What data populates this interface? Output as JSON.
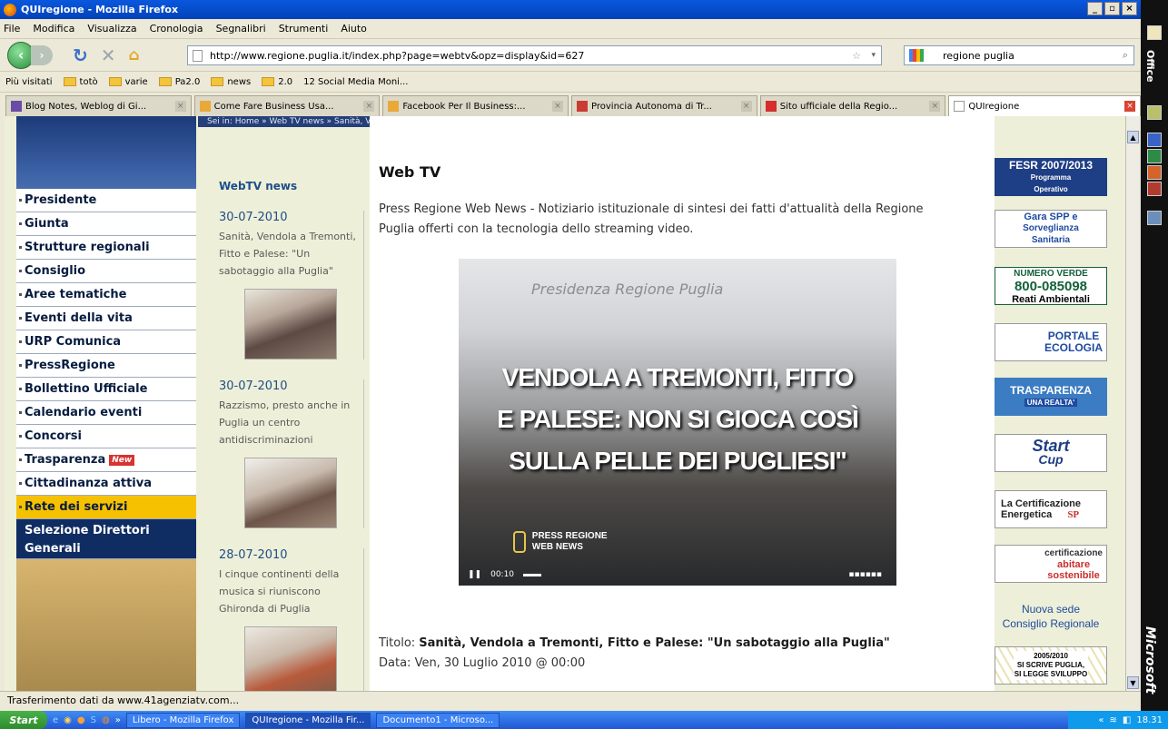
{
  "window": {
    "title": "QUIregione - Mozilla Firefox",
    "buttons": [
      "_",
      "▫",
      "×"
    ]
  },
  "menu": [
    "File",
    "Modifica",
    "Visualizza",
    "Cronologia",
    "Segnalibri",
    "Strumenti",
    "Aiuto"
  ],
  "nav": {
    "url": "http://www.regione.puglia.it/index.php?page=webtv&opz=display&id=627",
    "search": "regione puglia"
  },
  "bookmarks": [
    "Più visitati",
    "totò",
    "varie",
    "Pa2.0",
    "news",
    "2.0",
    "12 Social Media Moni..."
  ],
  "tabs": [
    "Blog Notes, Weblog di Gi...",
    "Come Fare Business Usa...",
    "Facebook Per Il Business:...",
    "Provincia Autonoma di Tr...",
    "Sito ufficiale della Regio...",
    "QUIregione"
  ],
  "breadcrumb": "Sei in: Home » Web TV news » Sanità, Vendola a Tremonti, Fitto e Palese: \"Un sabotaggio alla Puglia\"",
  "sidebar": {
    "items": [
      "Presidente",
      "Giunta",
      "Strutture regionali",
      "Consiglio",
      "Aree tematiche",
      "Eventi della vita",
      "URP Comunica",
      "PressRegione",
      "Bollettino Ufficiale",
      "Calendario eventi",
      "Concorsi",
      "Trasparenza",
      "Cittadinanza attiva",
      "Rete dei servizi",
      "Selezione Direttori Generali"
    ],
    "new_badge": "New"
  },
  "news": {
    "heading": "WebTV news",
    "items": [
      {
        "date": "30-07-2010",
        "text": "Sanità, Vendola a Tremonti, Fitto e Palese: \"Un sabotaggio alla Puglia\""
      },
      {
        "date": "30-07-2010",
        "text": "Razzismo, presto anche in Puglia un centro antidiscriminazioni"
      },
      {
        "date": "28-07-2010",
        "text": "I cinque continenti della musica si riuniscono Ghironda di Puglia"
      }
    ]
  },
  "main": {
    "title": "Web TV",
    "intro": "Press Regione Web News - Notiziario istituzionale di sintesi dei fatti d'attualità della Regione Puglia offerti con la tecnologia dello streaming video.",
    "video": {
      "banner": "Presidenza Regione Puglia",
      "caption_lines": [
        "VENDOLA A TREMONTI, FITTO",
        "E PALESE: NON SI GIOCA COSÌ",
        "SULLA PELLE DEI PUGLIESI\""
      ],
      "logo": [
        "PRESS REGIONE",
        "WEB NEWS"
      ],
      "time": "00:10"
    },
    "meta_title_label": "Titolo:",
    "meta_title": "Sanità, Vendola a Tremonti, Fitto e Palese: \"Un sabotaggio alla Puglia\"",
    "meta_date_label": "Data:",
    "meta_date": "Ven, 30 Luglio 2010 @ 00:00"
  },
  "banners": [
    {
      "line1": "FESR 2007/2013",
      "line2": "Programma",
      "line3": "Operativo"
    },
    {
      "line1": "Gara SPP e",
      "line2": "Sorveglianza",
      "line3": "Sanitaria"
    },
    {
      "line1": "NUMERO VERDE",
      "line2": "800-085098",
      "line3": "Reati Ambientali"
    },
    {
      "line1": "PORTALE",
      "line2": "ECOLOGIA",
      "line3": ""
    },
    {
      "line1": "TRASPARENZA",
      "line2": "UNA REALTA'",
      "line3": ""
    },
    {
      "line1": "Start",
      "line2": "Cup",
      "line3": ""
    },
    {
      "line1": "La Certificazione",
      "line2": "Energetica",
      "line3": "SP"
    },
    {
      "line1": "certificazione",
      "line2": "abitare",
      "line3": "sostenibile"
    },
    {
      "line1": "Nuova sede",
      "line2": "Consiglio Regionale",
      "line3": ""
    },
    {
      "line1": "2005/2010",
      "line2": "SI SCRIVE PUGLIA,",
      "line3": "SI LEGGE SVILUPPO"
    }
  ],
  "status": "Trasferimento dati da www.41agenziatv.com...",
  "taskbar": {
    "start": "Start",
    "items": [
      "Libero - Mozilla Firefox",
      "QUIregione - Mozilla Fir...",
      "Documento1 - Microso..."
    ],
    "clock": "18.31"
  },
  "office": {
    "label": "Office",
    "brand": "Microsoft"
  }
}
